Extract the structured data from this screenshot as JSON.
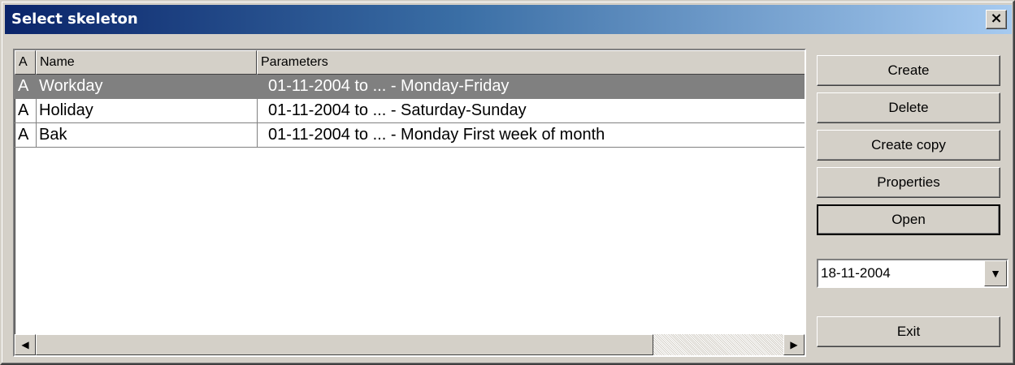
{
  "window": {
    "title": "Select skeleton",
    "close_glyph": "×"
  },
  "list": {
    "columns": {
      "a": "A",
      "name": "Name",
      "params": "Parameters"
    },
    "rows": [
      {
        "a": "A",
        "name": "Workday",
        "params": "01-11-2004 to ... - Monday-Friday",
        "selected": true
      },
      {
        "a": "A",
        "name": "Holiday",
        "params": "01-11-2004 to ... - Saturday-Sunday",
        "selected": false
      },
      {
        "a": "A",
        "name": "Bak",
        "params": "01-11-2004 to ... - Monday First week of month",
        "selected": false
      }
    ]
  },
  "scrollbar": {
    "left_icon": "◀",
    "right_icon": "▶"
  },
  "buttons": {
    "create": "Create",
    "delete": "Delete",
    "create_copy": "Create copy",
    "properties": "Properties",
    "open": "Open",
    "exit": "Exit"
  },
  "date_select": {
    "value": "18-11-2004",
    "dropdown_icon": "▼"
  },
  "colors": {
    "selected_row": "#808080",
    "title_start": "#0a246a",
    "face": "#d4d0c8"
  }
}
